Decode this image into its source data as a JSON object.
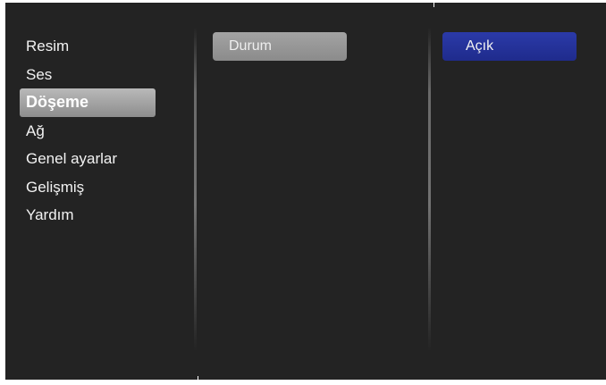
{
  "menu": {
    "items": [
      {
        "label": "Resim"
      },
      {
        "label": "Ses"
      },
      {
        "label": "Döşeme"
      },
      {
        "label": "Ağ"
      },
      {
        "label": "Genel ayarlar"
      },
      {
        "label": "Gelişmiş"
      },
      {
        "label": "Yardım"
      }
    ],
    "selected": "Döşeme"
  },
  "submenu": {
    "setting_label": "Durum"
  },
  "value": {
    "current": "Açık"
  },
  "colors": {
    "background": "#232323",
    "selected_menu": "#a3a3a3",
    "value_highlight": "#2433a0",
    "text": "#f2f2f2"
  }
}
